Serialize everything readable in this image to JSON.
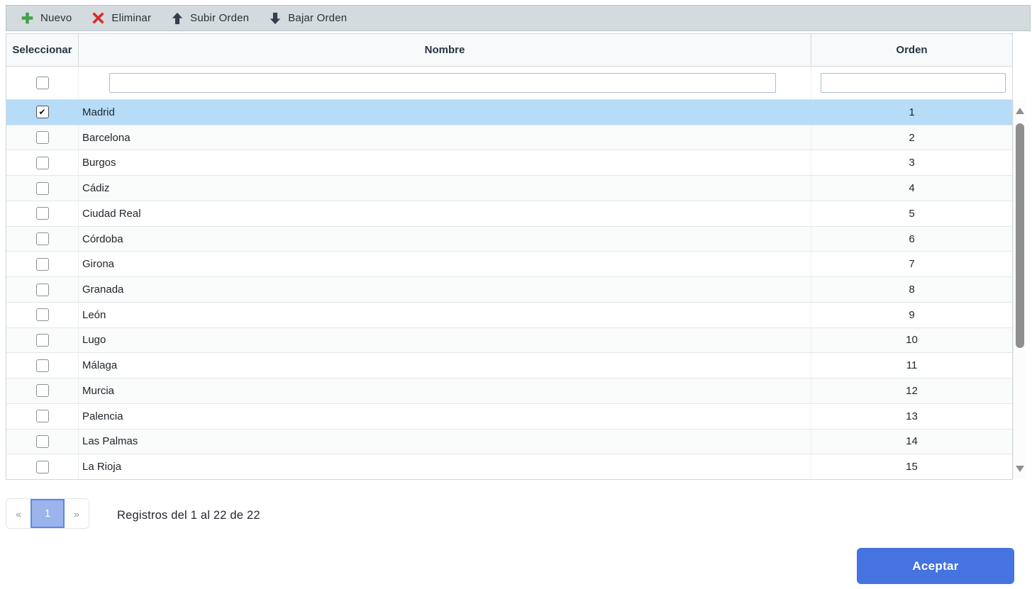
{
  "toolbar": {
    "buttons": [
      {
        "label": "Nuevo",
        "icon": "plus-icon",
        "color": "#43a047"
      },
      {
        "label": "Eliminar",
        "icon": "x-icon",
        "color": "#d32f2f"
      },
      {
        "label": "Subir Orden",
        "icon": "arrow-up-icon",
        "color": "#333f4d"
      },
      {
        "label": "Bajar Orden",
        "icon": "arrow-down-icon",
        "color": "#333f4d"
      }
    ]
  },
  "table": {
    "columns": [
      {
        "label": "Seleccionar"
      },
      {
        "label": "Nombre"
      },
      {
        "label": "Orden"
      }
    ],
    "filter": {
      "select_all_checked": false,
      "nombre_value": "",
      "orden_value": ""
    },
    "rows": [
      {
        "name": "Madrid",
        "orden": "1",
        "checked": true,
        "selected": true
      },
      {
        "name": "Barcelona",
        "orden": "2",
        "checked": false,
        "selected": false
      },
      {
        "name": "Burgos",
        "orden": "3",
        "checked": false,
        "selected": false
      },
      {
        "name": "Cádiz",
        "orden": "4",
        "checked": false,
        "selected": false
      },
      {
        "name": "Ciudad Real",
        "orden": "5",
        "checked": false,
        "selected": false
      },
      {
        "name": "Córdoba",
        "orden": "6",
        "checked": false,
        "selected": false
      },
      {
        "name": "Girona",
        "orden": "7",
        "checked": false,
        "selected": false
      },
      {
        "name": "Granada",
        "orden": "8",
        "checked": false,
        "selected": false
      },
      {
        "name": "León",
        "orden": "9",
        "checked": false,
        "selected": false
      },
      {
        "name": "Lugo",
        "orden": "10",
        "checked": false,
        "selected": false
      },
      {
        "name": "Málaga",
        "orden": "11",
        "checked": false,
        "selected": false
      },
      {
        "name": "Murcia",
        "orden": "12",
        "checked": false,
        "selected": false
      },
      {
        "name": "Palencia",
        "orden": "13",
        "checked": false,
        "selected": false
      },
      {
        "name": "Las Palmas",
        "orden": "14",
        "checked": false,
        "selected": false
      },
      {
        "name": "La Rioja",
        "orden": "15",
        "checked": false,
        "selected": false
      }
    ]
  },
  "scrollbar": {
    "up_icon": "scroll-up-icon",
    "down_icon": "scroll-down-icon"
  },
  "pagination": {
    "prev_label": "«",
    "active_page": "1",
    "next_label": "»",
    "summary": "Registros del 1 al 22 de 22"
  },
  "footer": {
    "accept_label": "Aceptar"
  },
  "colors": {
    "toolbar_bg": "#d4dbde",
    "selected_row_bg": "#b7dcf8",
    "alt_row_bg": "#fafbfb",
    "accent_blue": "#4573e0",
    "pagination_active_bg": "#9cb4ec",
    "pagination_active_border": "#5d87e6",
    "filter_input_border": "#a6bedb",
    "scrollbar_thumb": "#8f8f8f",
    "green": "#43a047",
    "red": "#d32f2f",
    "arrow_navy": "#333f4d"
  }
}
